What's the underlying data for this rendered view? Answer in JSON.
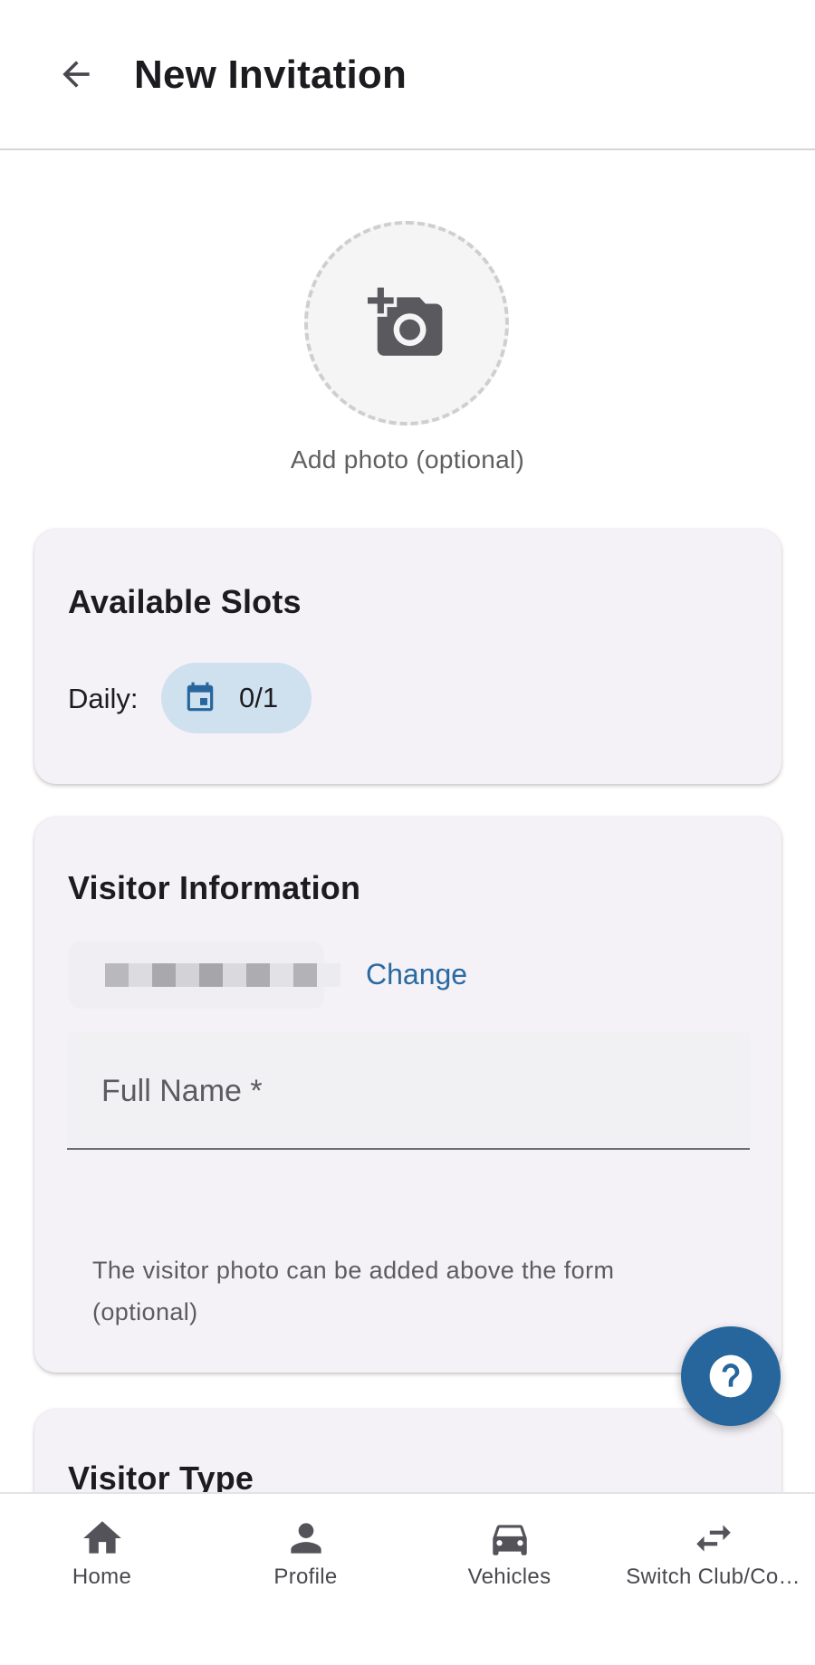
{
  "header": {
    "title": "New Invitation"
  },
  "photo": {
    "caption": "Add photo (optional)"
  },
  "slots_card": {
    "title": "Available Slots",
    "daily_label": "Daily:",
    "daily_value": "0/1"
  },
  "visitor_card": {
    "title": "Visitor Information",
    "change_label": "Change",
    "full_name_label": "Full Name *",
    "helper_text": "The visitor photo can be added above the form (optional)"
  },
  "visitor_type_card": {
    "title": "Visitor Type"
  },
  "bottom_nav": {
    "items": [
      {
        "label": "Home",
        "icon": "home-icon"
      },
      {
        "label": "Profile",
        "icon": "person-icon"
      },
      {
        "label": "Vehicles",
        "icon": "car-icon"
      },
      {
        "label": "Switch Club/Co…",
        "icon": "swap-icon"
      }
    ]
  },
  "colors": {
    "accent": "#27669c",
    "link": "#2a6aa1",
    "card_bg": "#f4f2f7",
    "chip_bg": "#cfe0ef"
  }
}
